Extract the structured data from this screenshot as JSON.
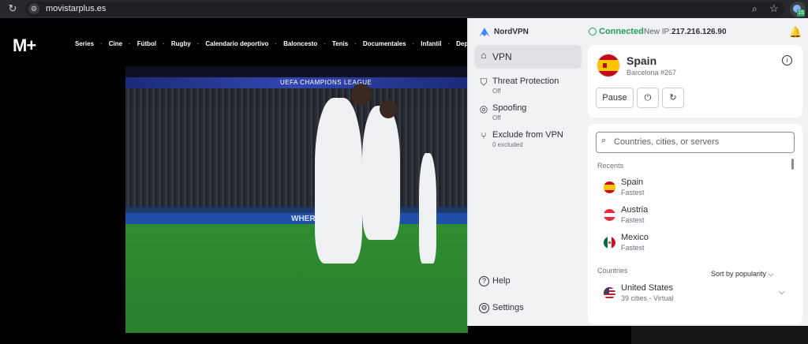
{
  "browser": {
    "url": "movistarplus.es",
    "reload_glyph": "↻",
    "site_info_glyph": "⚙",
    "zoom_glyph": "⌕",
    "star_glyph": "☆",
    "ext_badge": "15"
  },
  "site": {
    "logo": "M+",
    "nav": [
      "Series",
      "Cine",
      "Fútbol",
      "Rugby",
      "Calendario deportivo",
      "Baloncesto",
      "Tenis",
      "Documentales",
      "Infantil",
      "Deportes"
    ],
    "hero": {
      "banner_text": "UEFA CHAMPIONS LEAGUE",
      "adboard_text": "WHERE LEGENDS TRADE"
    }
  },
  "nordvpn": {
    "brand": "NordVPN",
    "status": "Connected",
    "ip_label": "New IP:",
    "ip": "217.216.126.90",
    "bell_glyph": "🔔",
    "sidebar": [
      {
        "label": "VPN",
        "sub": "",
        "icon": "⌂",
        "active": true
      },
      {
        "label": "Threat Protection",
        "sub": "Off",
        "icon": "⛉",
        "active": false
      },
      {
        "label": "Spoofing",
        "sub": "Off",
        "icon": "◎",
        "active": false
      },
      {
        "label": "Exclude from VPN",
        "sub": "0 excluded",
        "icon": "⑂",
        "active": false
      }
    ],
    "help_label": "Help",
    "help_glyph": "?",
    "settings_label": "Settings",
    "settings_glyph": "⚙",
    "connection": {
      "country": "Spain",
      "server": "Barcelona #267",
      "info_glyph": "i",
      "pause_label": "Pause",
      "power_glyph": "⏻",
      "refresh_glyph": "↻"
    },
    "search_glyph": "⌕",
    "search_placeholder": "Countries, cities, or servers",
    "recents_title": "Recents",
    "recents": [
      {
        "name": "Spain",
        "sub": "Fastest",
        "flag": "es"
      },
      {
        "name": "Austria",
        "sub": "Fastest",
        "flag": "at"
      },
      {
        "name": "Mexico",
        "sub": "Fastest",
        "flag": "mx"
      }
    ],
    "countries_title": "Countries",
    "sort_label": "Sort by popularity ⌵",
    "countries": [
      {
        "name": "United States",
        "sub": "39 cities - Virtual",
        "flag": "us",
        "chevron": "⌵"
      }
    ]
  }
}
